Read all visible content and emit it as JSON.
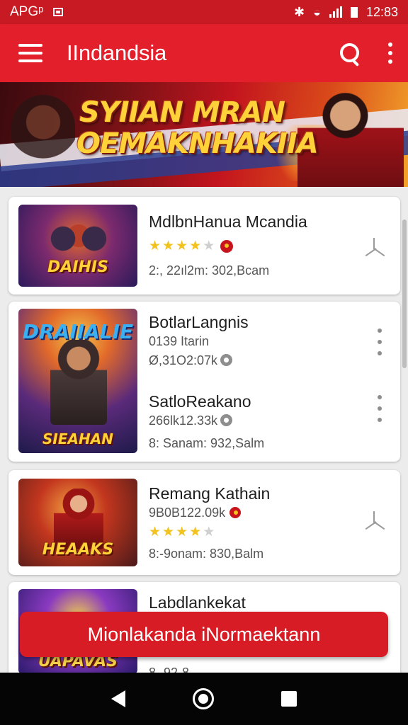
{
  "status_bar": {
    "left_label": "APGᵖ",
    "time": "12:83"
  },
  "app_bar": {
    "title": "IIndandsia"
  },
  "banner": {
    "line1": "SYIIAN MRAN",
    "line2": "OEMAKNHAKIIA"
  },
  "items": [
    {
      "name": "MdlbnHanua Mcandia",
      "rating": 3.5,
      "meta": "2:, 22ıl2m:  302,Bcam",
      "thumb_text": "DAIHIS"
    },
    {
      "name": "BotlarLangnis",
      "meta1": "0139 Itarin",
      "meta2": "Ø,31O2:07k",
      "thumb_text_top": "DRAIIALIE",
      "thumb_text_bottom": "SIEAHAN"
    },
    {
      "name": "SatloReakano",
      "meta1": "266lk12.33k",
      "meta2": "8:  Sanam:  932,Salm"
    },
    {
      "name": "Remang Kathain",
      "rating": 3.5,
      "meta1": "9B0B122.09k",
      "meta2": "8:-9onam:  830,Balm",
      "thumb_text": "HEAAKS"
    },
    {
      "name": "Labdlankekat",
      "meta1": "8· 92·8·",
      "thumb_text": "UAPAVAS"
    }
  ],
  "cta": {
    "label": "Mionlakanda iNormaektann"
  },
  "colors": {
    "primary": "#e21f2a",
    "status_bar": "#c81a22",
    "star": "#f2c31e"
  },
  "icons": [
    "menu-icon",
    "search-icon",
    "more-vert-icon",
    "bluetooth-icon",
    "wifi-icon",
    "signal-icon",
    "battery-icon",
    "install-icon",
    "back-icon",
    "home-icon",
    "recents-icon"
  ]
}
